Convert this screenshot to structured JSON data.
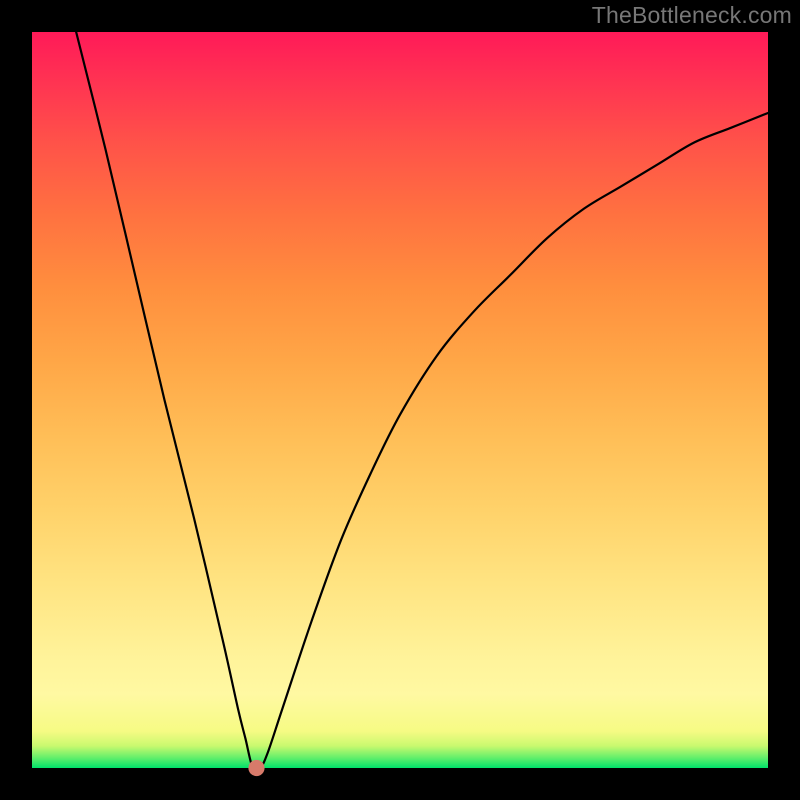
{
  "watermark": "TheBottleneck.com",
  "colors": {
    "frame": "#000000",
    "curve": "#000000",
    "marker": "#d77a6a"
  },
  "chart_data": {
    "type": "line",
    "title": "",
    "xlabel": "",
    "ylabel": "",
    "xlim": [
      0,
      100
    ],
    "ylim": [
      0,
      100
    ],
    "grid": false,
    "legend": false,
    "series": [
      {
        "name": "bottleneck-curve",
        "x": [
          6,
          10,
          14,
          18,
          22,
          26,
          28,
          29,
          30,
          31,
          32,
          34,
          38,
          42,
          46,
          50,
          55,
          60,
          65,
          70,
          75,
          80,
          85,
          90,
          95,
          100
        ],
        "y": [
          100,
          84,
          67,
          50,
          34,
          17,
          8,
          4,
          0,
          0,
          2,
          8,
          20,
          31,
          40,
          48,
          56,
          62,
          67,
          72,
          76,
          79,
          82,
          85,
          87,
          89
        ]
      }
    ],
    "marker": {
      "x": 30.5,
      "y": 0,
      "radius_percent": 1.1
    },
    "background_gradient": {
      "direction": "bottom-to-top",
      "stops": [
        {
          "pos": 0,
          "color": "#00e26a"
        },
        {
          "pos": 3,
          "color": "#c9f96f"
        },
        {
          "pos": 10,
          "color": "#fff9a2"
        },
        {
          "pos": 35,
          "color": "#ffd26a"
        },
        {
          "pos": 65,
          "color": "#ff8f3e"
        },
        {
          "pos": 85,
          "color": "#ff5249"
        },
        {
          "pos": 100,
          "color": "#ff1a58"
        }
      ]
    }
  }
}
